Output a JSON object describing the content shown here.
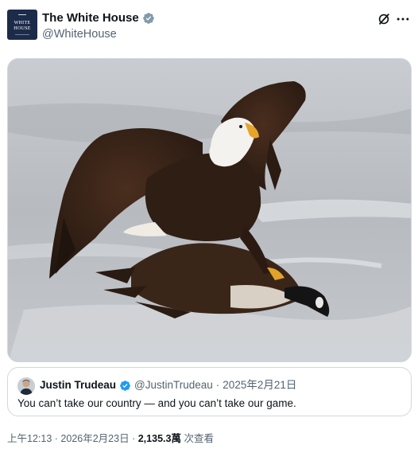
{
  "author": {
    "display_name": "The White House",
    "handle": "@WhiteHouse",
    "avatar_text_line1": "WHITE",
    "avatar_text_line2": "HOUSE",
    "verified_badge_icon": "verified-badge-icon",
    "badge_color": "#829aab"
  },
  "header_actions": {
    "grok_icon": "grok-icon",
    "more_icon": "more-icon"
  },
  "media": {
    "type": "photo",
    "subject_icon": "bald-eagle-on-goose-photo"
  },
  "quoted_post": {
    "display_name": "Justin Trudeau",
    "handle": "@JustinTrudeau",
    "separator": "·",
    "date": "2025年2月21日",
    "text": "You can’t take our country — and you can’t take our game.",
    "verified_badge_icon": "verified-badge-icon",
    "badge_color": "#1d9bf0"
  },
  "meta": {
    "time": "上午12:13",
    "separator1": "·",
    "date": "2026年2月23日",
    "separator2": "·",
    "views_count": "2,135.3萬",
    "views_label": "次查看"
  }
}
